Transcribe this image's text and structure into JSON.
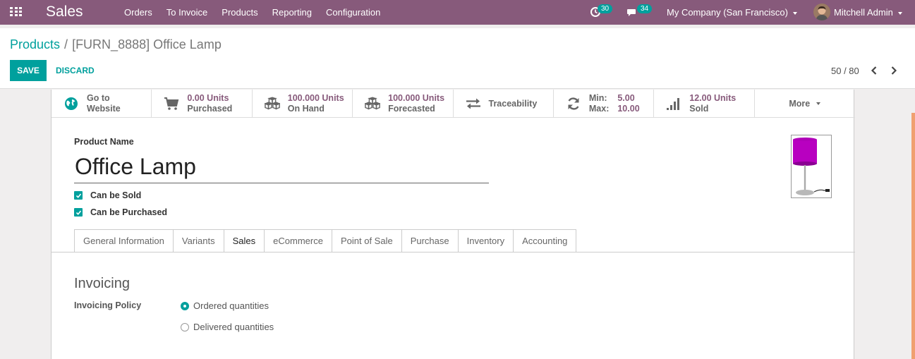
{
  "navbar": {
    "app_name": "Sales",
    "menu": [
      "Orders",
      "To Invoice",
      "Products",
      "Reporting",
      "Configuration"
    ],
    "activity_count": "30",
    "messages_count": "34",
    "company": "My Company (San Francisco)",
    "user": "Mitchell Admin"
  },
  "breadcrumb": {
    "parent": "Products",
    "separator": "/",
    "current": "[FURN_8888] Office Lamp"
  },
  "toolbar": {
    "save_label": "SAVE",
    "discard_label": "DISCARD"
  },
  "pager": {
    "text": "50 / 80"
  },
  "stat_buttons": {
    "website": {
      "line1": "Go to",
      "line2": "Website"
    },
    "purchased": {
      "value": "0.00 Units",
      "label": "Purchased"
    },
    "on_hand": {
      "value": "100.000 Units",
      "label": "On Hand"
    },
    "forecasted": {
      "value": "100.000 Units",
      "label": "Forecasted"
    },
    "traceability": {
      "label": "Traceability"
    },
    "reordering": {
      "min_label": "Min:",
      "min_value": "5.00",
      "max_label": "Max:",
      "max_value": "10.00"
    },
    "sold": {
      "value": "12.00 Units",
      "label": "Sold"
    },
    "more": {
      "label": "More"
    }
  },
  "form": {
    "product_name_label": "Product Name",
    "product_name": "Office Lamp",
    "can_be_sold": "Can be Sold",
    "can_be_purchased": "Can be Purchased"
  },
  "tabs": [
    "General Information",
    "Variants",
    "Sales",
    "eCommerce",
    "Point of Sale",
    "Purchase",
    "Inventory",
    "Accounting"
  ],
  "active_tab": "Sales",
  "sales_tab": {
    "section_title": "Invoicing",
    "policy_label": "Invoicing Policy",
    "options": [
      "Ordered quantities",
      "Delivered quantities"
    ],
    "selected": "Ordered quantities"
  },
  "colors": {
    "navbar": "#875a7b",
    "accent": "#00a09d",
    "stat_value": "#875a7b"
  },
  "icons": [
    "apps-grid-icon",
    "clock-icon",
    "chat-icon",
    "globe-icon",
    "cart-icon",
    "cubes-icon",
    "exchange-icon",
    "refresh-icon",
    "bar-chart-icon",
    "chevron-left-icon",
    "chevron-right-icon"
  ]
}
